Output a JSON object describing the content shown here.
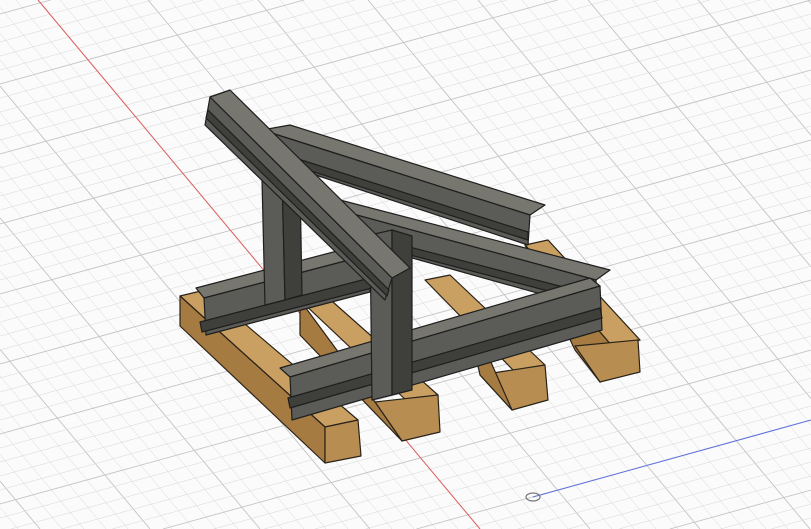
{
  "viewport": {
    "type": "3d-cad-canvas",
    "model": "rail-and-sleeper-support-structure",
    "colors": {
      "grid": "#d6d6d6",
      "x_axis": "#e05050",
      "z_axis": "#5060e0",
      "steel": "#5b5b57",
      "wood": "#c9a062"
    }
  }
}
